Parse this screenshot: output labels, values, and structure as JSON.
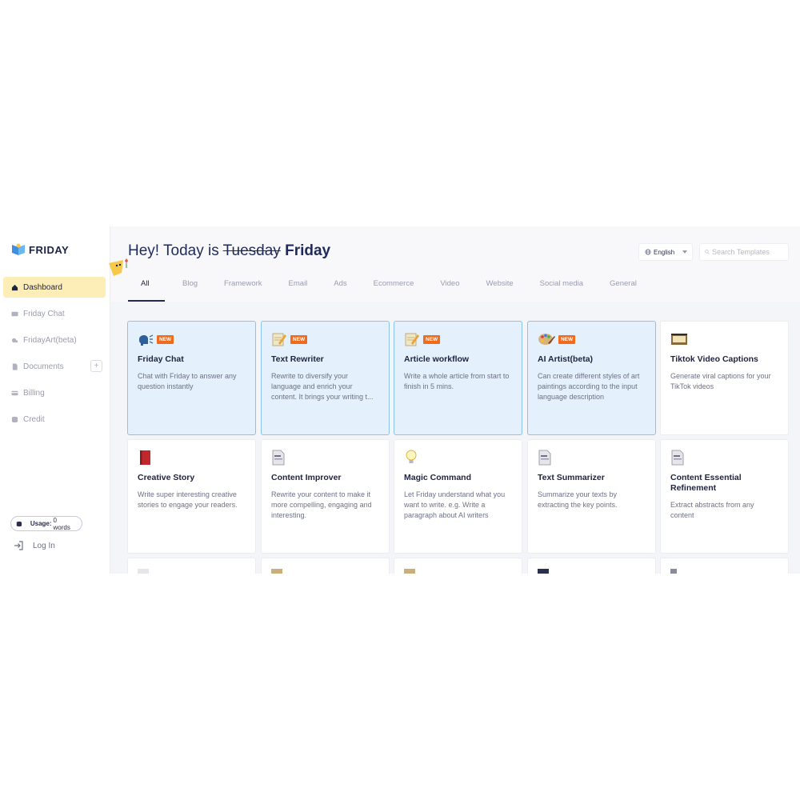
{
  "app": {
    "name": "FRIDAY"
  },
  "sidebar": {
    "items": [
      {
        "label": "Dashboard",
        "icon": "home-icon",
        "active": true
      },
      {
        "label": "Friday Chat",
        "icon": "chat-icon"
      },
      {
        "label": "FridayArt(beta)",
        "icon": "brush-icon"
      },
      {
        "label": "Documents",
        "icon": "document-icon",
        "plus": "+"
      },
      {
        "label": "Billing",
        "icon": "card-icon"
      },
      {
        "label": "Credit",
        "icon": "database-icon"
      }
    ],
    "usage_label": "Usage:",
    "usage_value": "0 words",
    "login_label": "Log In"
  },
  "header": {
    "greeting_prefix": "Hey! Today is",
    "struck_day": "Tuesday",
    "day": "Friday",
    "language": "English",
    "search_placeholder": "Search Templates"
  },
  "tabs": [
    "All",
    "Blog",
    "Framework",
    "Email",
    "Ads",
    "Ecommerce",
    "Video",
    "Website",
    "Social media",
    "General"
  ],
  "cards": [
    {
      "title": "Friday Chat",
      "desc": "Chat with Friday to answer any question instantly",
      "icon": "speech-head-icon",
      "badge": "NEW",
      "highlight": true
    },
    {
      "title": "Text Rewriter",
      "desc": "Rewrite to diversify your language and enrich your content. It brings your writing t...",
      "icon": "notepad-icon",
      "badge": "NEW",
      "highlight": true
    },
    {
      "title": "Article workflow",
      "desc": "Write a whole article from start to finish in 5 mins.",
      "icon": "notepad-icon",
      "badge": "NEW",
      "highlight": true
    },
    {
      "title": "AI Artist(beta)",
      "desc": "Can create different styles of art paintings according to the input language description",
      "icon": "palette-icon",
      "badge": "NEW",
      "highlight": true
    },
    {
      "title": "Tiktok Video Captions",
      "desc": "Generate viral captions for your TikTok videos",
      "icon": "film-icon",
      "badge": "",
      "highlight": false
    },
    {
      "title": "Creative Story",
      "desc": "Write super interesting creative stories to engage your readers.",
      "icon": "book-icon",
      "badge": "",
      "highlight": false
    },
    {
      "title": "Content Improver",
      "desc": "Rewrite your content to make it more compelling, engaging and interesting.",
      "icon": "page-icon",
      "badge": "",
      "highlight": false
    },
    {
      "title": "Magic Command",
      "desc": "Let Friday understand what you want to write. e.g. Write a paragraph about AI writers",
      "icon": "lightbulb-icon",
      "badge": "",
      "highlight": false
    },
    {
      "title": "Text Summarizer",
      "desc": "Summarize your texts by extracting the key points.",
      "icon": "page-icon",
      "badge": "",
      "highlight": false
    },
    {
      "title": "Content Essential Refinement",
      "desc": "Extract abstracts from any content",
      "icon": "page-icon",
      "badge": "",
      "highlight": false
    }
  ],
  "colors": {
    "accent": "#fdeeb8",
    "highlight_bg": "#e4f0fb",
    "highlight_border": "#8cc3ee",
    "badge": "#f26b1d",
    "title": "#1f2a5c"
  }
}
